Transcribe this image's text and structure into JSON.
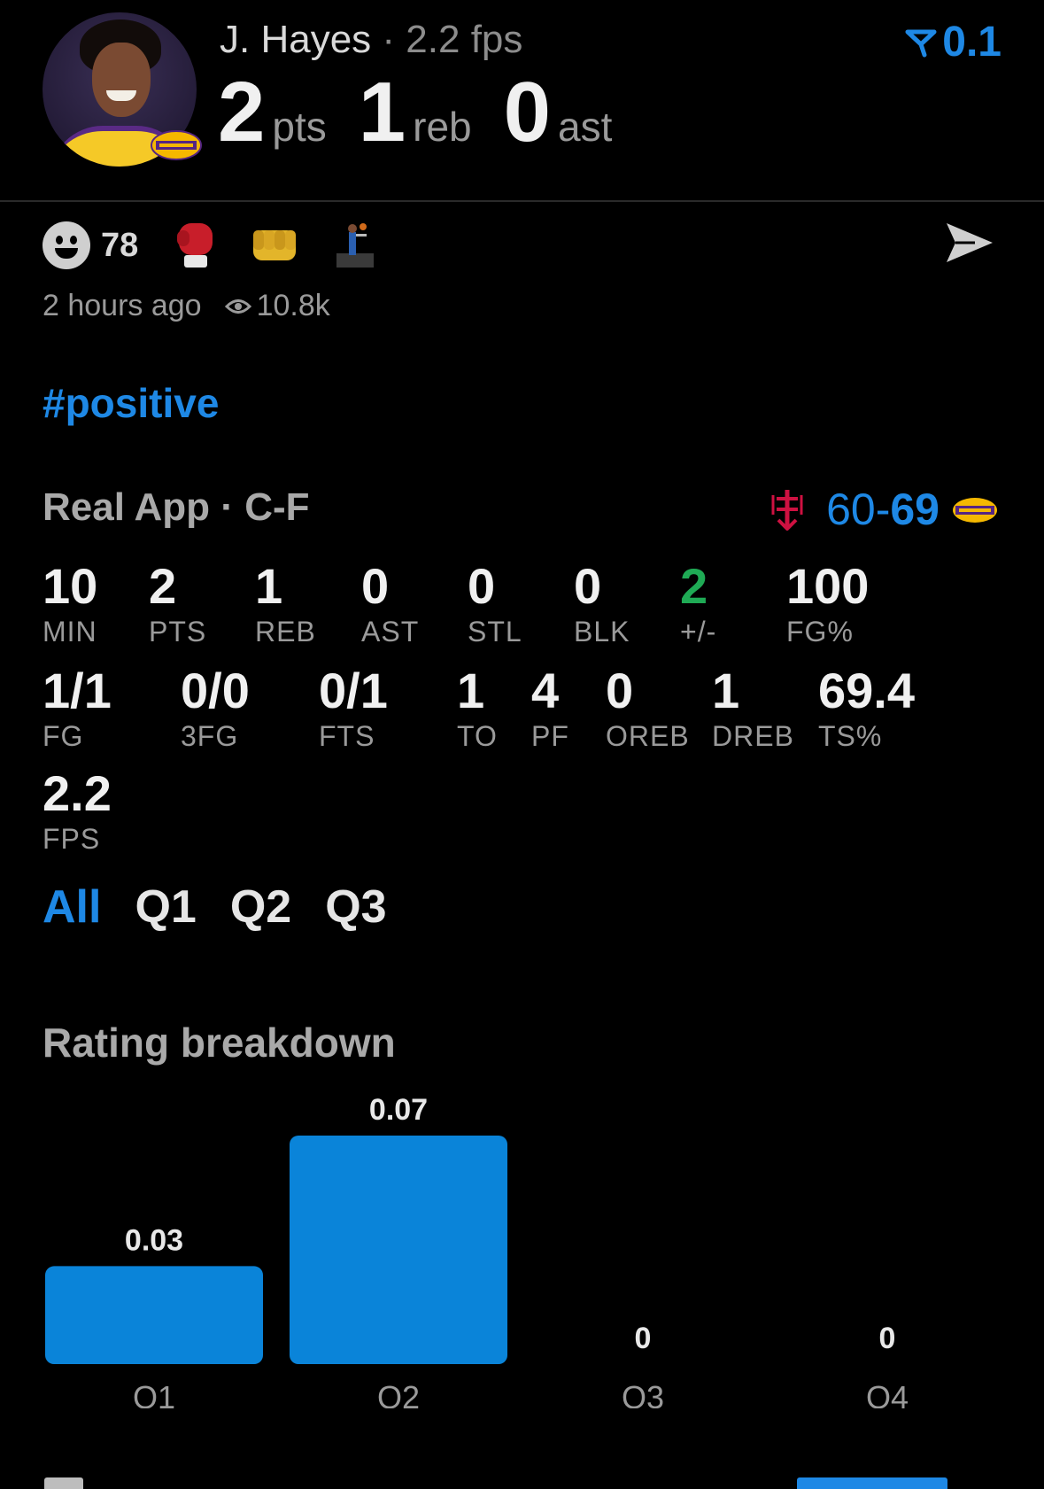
{
  "header": {
    "player_name": "J. Hayes",
    "separator": "·",
    "fps_text": "2.2 fps",
    "stats": [
      {
        "value": "2",
        "unit": "pts"
      },
      {
        "value": "1",
        "unit": "reb"
      },
      {
        "value": "0",
        "unit": "ast"
      }
    ],
    "rating_delta": "0.1",
    "rating_icon": "rating-arrow-icon",
    "accent_color": "#1e88e5"
  },
  "reactions": {
    "count": "78",
    "icons": [
      "smiley-icon",
      "boxing-glove-icon",
      "fist-icon",
      "dunk-icon"
    ],
    "share_icon": "send-icon"
  },
  "meta": {
    "time_ago": "2 hours ago",
    "views": "10.8k",
    "views_icon": "eye-icon"
  },
  "hashtag": "#positive",
  "game": {
    "source": "Real App",
    "separator": "·",
    "position": "C-F",
    "away_score": "60",
    "dash": "-",
    "home_score": "69",
    "away_team_icon": "rockets-logo-icon",
    "home_team_icon": "lakers-logo-icon"
  },
  "stats_grid": [
    {
      "value": "10",
      "label": "MIN"
    },
    {
      "value": "2",
      "label": "PTS"
    },
    {
      "value": "1",
      "label": "REB"
    },
    {
      "value": "0",
      "label": "AST"
    },
    {
      "value": "0",
      "label": "STL"
    },
    {
      "value": "0",
      "label": "BLK"
    },
    {
      "value": "2",
      "label": "+/-",
      "color": "#1faa55"
    },
    {
      "value": "100",
      "label": "FG%"
    },
    {
      "value": "1/1",
      "label": "FG"
    },
    {
      "value": "0/0",
      "label": "3FG"
    },
    {
      "value": "0/1",
      "label": "FTS"
    },
    {
      "value": "1",
      "label": "TO"
    },
    {
      "value": "4",
      "label": "PF"
    },
    {
      "value": "0",
      "label": "OREB"
    },
    {
      "value": "1",
      "label": "DREB"
    },
    {
      "value": "69.4",
      "label": "TS%"
    },
    {
      "value": "2.2",
      "label": "FPS"
    }
  ],
  "tabs": [
    {
      "label": "All",
      "active": true
    },
    {
      "label": "Q1",
      "active": false
    },
    {
      "label": "Q2",
      "active": false
    },
    {
      "label": "Q3",
      "active": false
    }
  ],
  "rating_breakdown": {
    "title": "Rating breakdown"
  },
  "chart_data": {
    "type": "bar",
    "categories": [
      "Q1",
      "Q2",
      "Q3",
      "Q4"
    ],
    "values": [
      0.03,
      0.07,
      0,
      0
    ],
    "value_labels": [
      "0.03",
      "0.07",
      "0",
      "0"
    ],
    "bar_color": "#0a84d9",
    "grid": false,
    "legend": "none"
  }
}
